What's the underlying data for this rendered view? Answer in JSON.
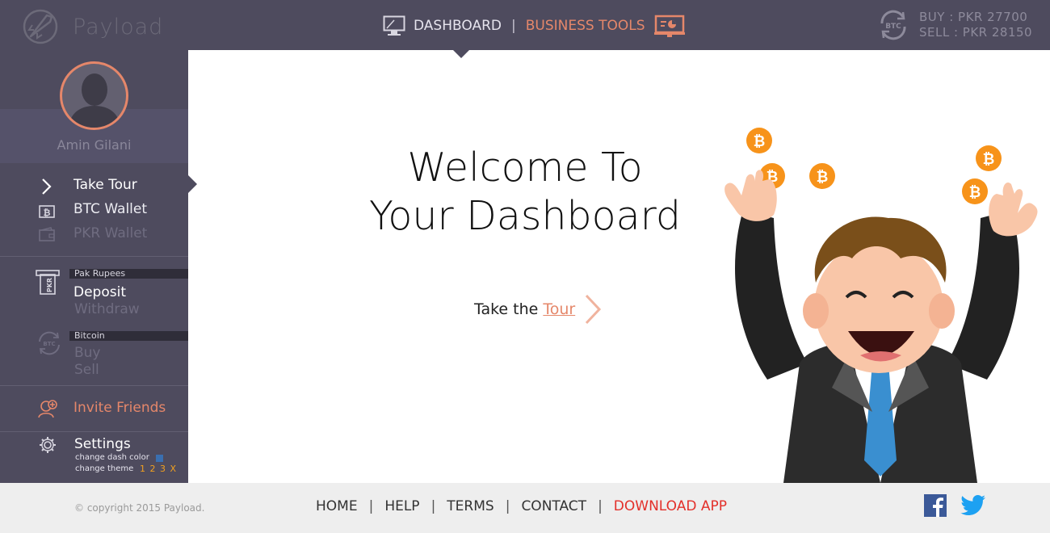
{
  "header": {
    "brand": "Payload",
    "nav_dashboard": "DASHBOARD",
    "nav_separator": "|",
    "nav_business_tools": "BUSINESS TOOLS",
    "btc_icon_label": "BTC",
    "buy_rate": "BUY : PKR 27700",
    "sell_rate": "SELL : PKR 28150"
  },
  "sidebar": {
    "username": "Amin Gilani",
    "take_tour": "Take Tour",
    "btc_wallet": "BTC Wallet",
    "pkr_wallet": "PKR Wallet",
    "pkr_group": "Pak Rupees",
    "pkr_icon_label": "PKR",
    "deposit": "Deposit",
    "withdraw": "Withdraw",
    "btc_group": "Bitcoin",
    "btc_icon_label": "BTC",
    "buy": "Buy",
    "sell": "Sell",
    "invite_friends": "Invite Friends",
    "settings": "Settings",
    "change_dash_color": "change dash color",
    "change_theme": "change theme",
    "theme_options": "1 2 3 X"
  },
  "main": {
    "welcome_line1": "Welcome To",
    "welcome_line2": "Your Dashboard",
    "tour_prefix": "Take the",
    "tour_link": "Tour"
  },
  "footer": {
    "copyright": "© copyright 2015 Payload.",
    "home": "HOME",
    "help": "HELP",
    "terms": "TERMS",
    "contact": "CONTACT",
    "download_app": "DOWNLOAD APP",
    "sep": "|"
  },
  "colors": {
    "header_bg": "#4e4b5e",
    "accent": "#e5876a",
    "download_red": "#e3302a",
    "footer_bg": "#eeeeee"
  },
  "icons": [
    "rocket-logo-icon",
    "monitor-icon",
    "presentation-chart-icon",
    "btc-exchange-icon",
    "chevron-right-icon",
    "btc-wallet-icon",
    "wallet-icon",
    "pkr-atm-icon",
    "btc-cycle-icon",
    "invite-friends-icon",
    "gear-icon",
    "facebook-icon",
    "twitter-icon"
  ]
}
